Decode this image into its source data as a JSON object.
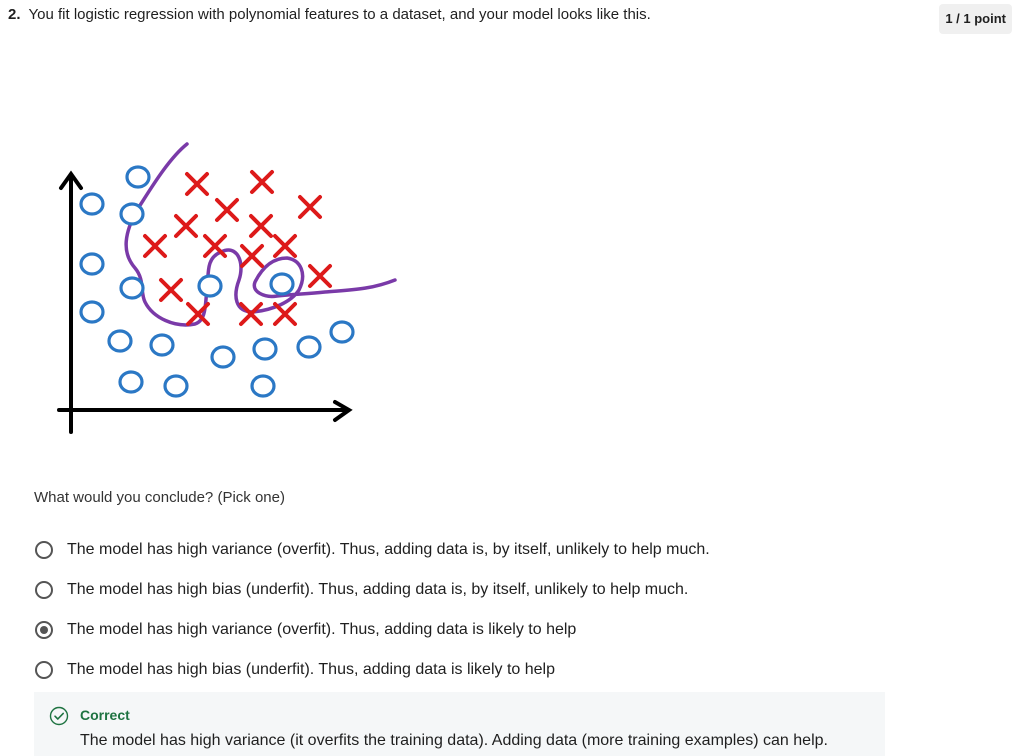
{
  "question": {
    "number": "2.",
    "text": "You fit logistic regression with polynomial features to a dataset, and your model looks like this.",
    "points": "1 / 1 point"
  },
  "figure": {
    "icon": "overfit-decision-boundary-plot",
    "circle_color": "#2b78c5",
    "cross_color": "#dd1a1a",
    "boundary_color": "#7a3aa8"
  },
  "prompt": "What would you conclude? (Pick one)",
  "options": [
    {
      "label": "The model has high variance (overfit). Thus, adding data is, by itself, unlikely to help much.",
      "selected": false
    },
    {
      "label": "The model has high bias (underfit). Thus, adding data is, by itself, unlikely to help much.",
      "selected": false
    },
    {
      "label": "The model has high variance (overfit). Thus, adding data is likely to help",
      "selected": true
    },
    {
      "label": "The model has high bias (underfit). Thus, adding data is likely to help",
      "selected": false
    }
  ],
  "feedback": {
    "status": "Correct",
    "icon": "check-circle-icon",
    "color": "#1e7341",
    "text": "The model has high variance (it overfits the training data). Adding data (more training examples) can help."
  }
}
